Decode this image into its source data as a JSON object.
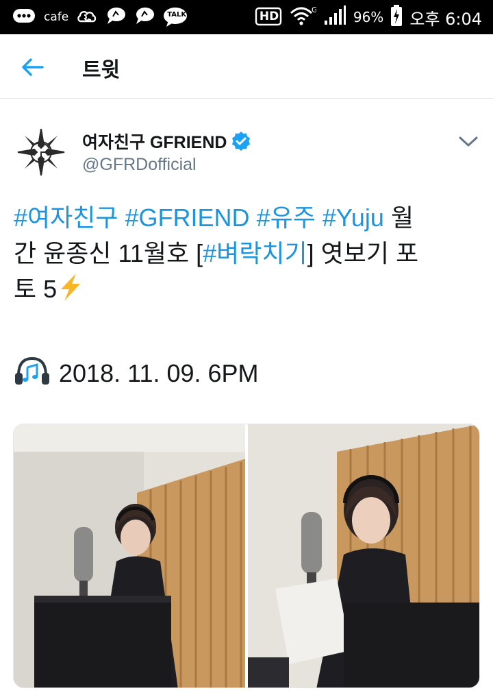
{
  "status_bar": {
    "app_label": "cafe",
    "talk_label": "TALK",
    "hd_label": "HD",
    "battery": "96%",
    "time": "오후 6:04"
  },
  "header": {
    "title": "트윗"
  },
  "tweet": {
    "display_name": "여자친구 GFRIEND",
    "handle": "@GFRDofficial",
    "tags": [
      "#여자친구",
      "#GFRIEND",
      "#유주",
      "#Yuju",
      "#벼락치기"
    ],
    "text_1": "월",
    "text_2": "간 윤종신 11월호 [",
    "text_3": "] 엿보기 포",
    "text_4": "토 5",
    "date_line": "2018. 11. 09. 6PM",
    "icons": [
      "verified-badge-icon",
      "chevron-down-icon",
      "lightning-emoji-icon",
      "headphones-emoji-icon"
    ],
    "colors": {
      "link": "#1b95e0",
      "verified": "#1da1f2"
    }
  }
}
